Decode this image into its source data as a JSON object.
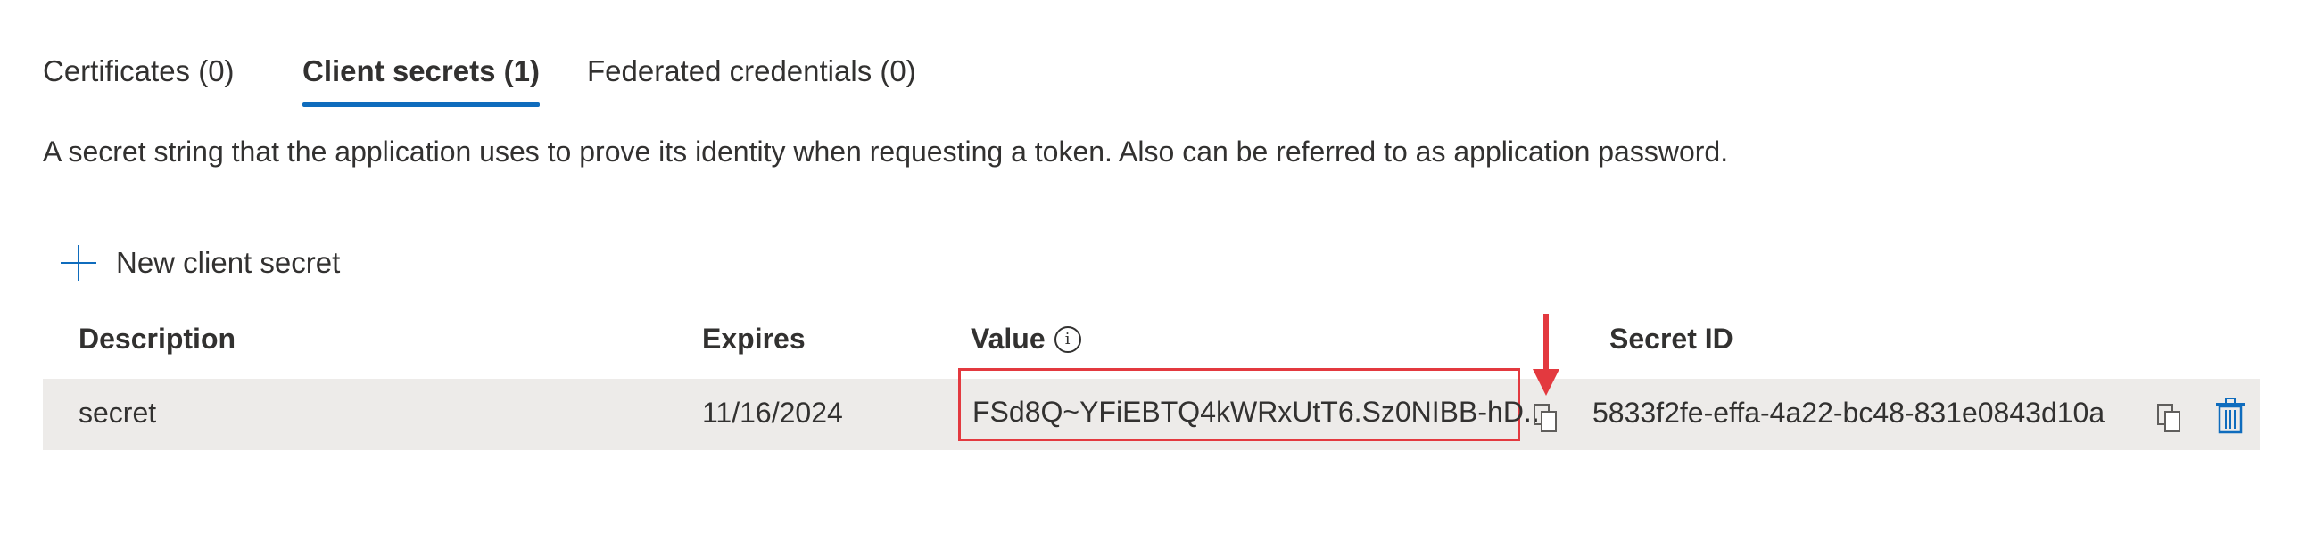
{
  "tabs": [
    {
      "label": "Certificates (0)",
      "active": false
    },
    {
      "label": "Client secrets (1)",
      "active": true
    },
    {
      "label": "Federated credentials (0)",
      "active": false
    }
  ],
  "description": "A secret string that the application uses to prove its identity when requesting a token. Also can be referred to as application password.",
  "toolbar": {
    "new_secret_label": "New client secret"
  },
  "table": {
    "columns": [
      "Description",
      "Expires",
      "Value",
      "Secret ID"
    ],
    "rows": [
      {
        "description": "secret",
        "expires": "11/16/2024",
        "value": "FSd8Q~YFiEBTQ4kWRxUtT6.Sz0NIBB-hD...",
        "secret_id": "5833f2fe-effa-4a22-bc48-831e0843d10a"
      }
    ]
  },
  "colors": {
    "accent": "#0f6cbd",
    "highlight": "#e3393f",
    "row_bg": "#edebe9"
  },
  "icons": [
    "plus-icon",
    "info-icon",
    "copy-icon",
    "delete-icon",
    "arrow-down-icon"
  ]
}
